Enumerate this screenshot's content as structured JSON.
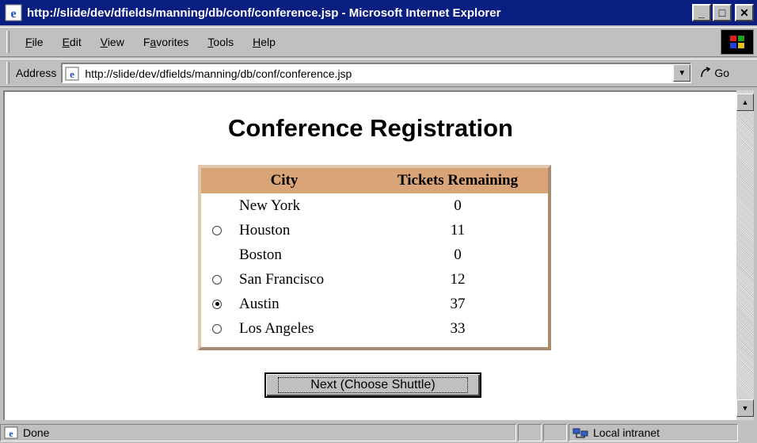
{
  "window": {
    "title": "http://slide/dev/dfields/manning/db/conf/conference.jsp - Microsoft Internet Explorer",
    "minimize": "_",
    "restore": "□",
    "close": "✕"
  },
  "menu": {
    "items": [
      {
        "accel": "F",
        "rest": "ile"
      },
      {
        "accel": "E",
        "rest": "dit"
      },
      {
        "accel": "V",
        "rest": "iew"
      },
      {
        "pre": "F",
        "accel": "a",
        "rest": "vorites"
      },
      {
        "accel": "T",
        "rest": "ools"
      },
      {
        "accel": "H",
        "rest": "elp"
      }
    ]
  },
  "address": {
    "label": "Address",
    "url": "http://slide/dev/dfields/manning/db/conf/conference.jsp",
    "go_label": "Go"
  },
  "page": {
    "title": "Conference Registration",
    "table": {
      "headers": {
        "city": "City",
        "tickets": "Tickets Remaining"
      },
      "rows": [
        {
          "city": "New York",
          "tickets": "0",
          "radio": false,
          "checked": false
        },
        {
          "city": "Houston",
          "tickets": "11",
          "radio": true,
          "checked": false
        },
        {
          "city": "Boston",
          "tickets": "0",
          "radio": false,
          "checked": false
        },
        {
          "city": "San Francisco",
          "tickets": "12",
          "radio": true,
          "checked": false
        },
        {
          "city": "Austin",
          "tickets": "37",
          "radio": true,
          "checked": true
        },
        {
          "city": "Los Angeles",
          "tickets": "33",
          "radio": true,
          "checked": false
        }
      ]
    },
    "next_button": "Next (Choose Shuttle)"
  },
  "status": {
    "text": "Done",
    "zone": "Local intranet"
  },
  "colors": {
    "titlebar": "#0a1e82",
    "table_header": "#d9a478",
    "table_border": "#c8a789",
    "chrome": "#c0c0c0"
  }
}
